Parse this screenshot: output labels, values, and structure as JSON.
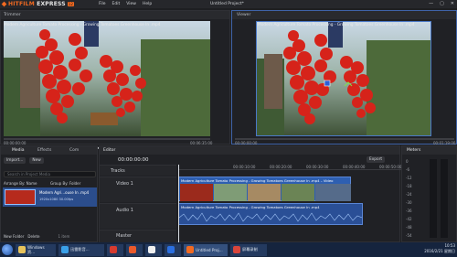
{
  "app": {
    "logo_text_hit": "HITFILM",
    "logo_text_express": " EXPRESS",
    "logo_badge": "12",
    "menus": [
      "File",
      "Edit",
      "View",
      "Help"
    ],
    "project_title": "Untitled Project*",
    "window_controls": [
      "—",
      "▢",
      "✕"
    ]
  },
  "trimmer": {
    "tab": "Trimmer",
    "filename": "Modern Agriculture Tomato Processing - Growing Tomatoes Greenhouse In .mp4",
    "tc_left": "00:00:00:00",
    "tc_right": "00:06:35:00",
    "zoom_label": "Full",
    "zoom_value": "(44.2%)",
    "progress": 0.0
  },
  "viewer": {
    "tab": "Viewer",
    "filename": "Modern Agriculture Tomato Processing - Growing Tomatoes Greenhouse In .mp4",
    "tc_left": "00:00:00:00",
    "tc_right": "00:01:19:00",
    "zoom_label": "Full",
    "zoom_value": "(44.2%)",
    "options_label": "Options",
    "progress": 0.0
  },
  "media": {
    "tabs": [
      "Media",
      "Effects",
      "Com"
    ],
    "import_label": "Import...",
    "new_label": "New",
    "search_placeholder": "Search in Project Media",
    "arrange_label": "Arrange By: Name",
    "group_label": "Group By: Folder",
    "item_title": "Modern Agri...ouse In .mp4",
    "item_subtitle": "1920x1080 30.00fps",
    "new_folder": "New Folder",
    "delete": "Delete",
    "item_count": "1 item"
  },
  "editor": {
    "tab": "Editor",
    "timecode": "00:00:00:00",
    "export_label": "Export",
    "tracks_label": "Tracks",
    "video_track": "Video 1",
    "audio_track": "Audio 1",
    "master_track": "Master",
    "clip_label": "Modern Agriculture Tomato Processing - Growing Tomatoes Greenhouse In .mp4 – Video",
    "audio_clip_label": "Modern Agriculture Tomato Processing - Growing Tomatoes Greenhouse In .mp4",
    "ruler_labels": [
      "00:00:10:00",
      "00:00:20:00",
      "00:00:30:00",
      "00:00:40:00",
      "00:00:50:00"
    ]
  },
  "meters": {
    "tab": "Meters",
    "scale": [
      "0",
      "-6",
      "-12",
      "-18",
      "-24",
      "-30",
      "-36",
      "-42",
      "-48",
      "-54"
    ]
  },
  "taskbar": {
    "items": [
      "Windows 资...",
      "迅雷影音...",
      "",
      "",
      "",
      "",
      "Untitled Proj...",
      "屏幕录制"
    ],
    "time": "10:53",
    "date": "2016/2/21 星期日"
  },
  "colors": {
    "accent": "#f26a21",
    "selection": "#3f63a8",
    "clip_blue": "#2e5fb1"
  }
}
